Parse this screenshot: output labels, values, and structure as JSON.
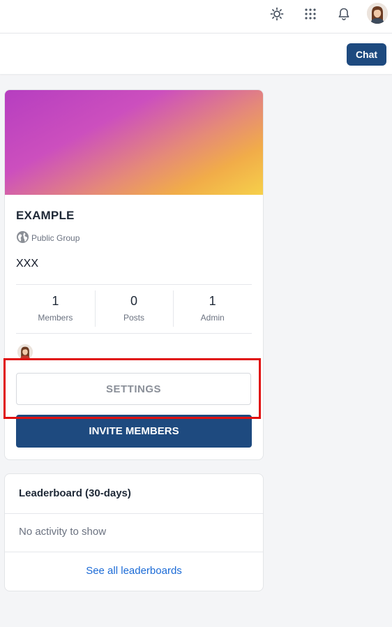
{
  "topbar": {
    "icons": [
      "sun-icon",
      "apps-grid-icon",
      "bell-icon",
      "user-avatar"
    ]
  },
  "subbar": {
    "chat_label": "Chat"
  },
  "group": {
    "name": "EXAMPLE",
    "privacy": "Public Group",
    "description": "XXX",
    "stats": [
      {
        "value": "1",
        "label": "Members"
      },
      {
        "value": "0",
        "label": "Posts"
      },
      {
        "value": "1",
        "label": "Admin"
      }
    ],
    "settings_label": "SETTINGS",
    "invite_label": "INVITE MEMBERS"
  },
  "leaderboard": {
    "title": "Leaderboard (30-days)",
    "empty_text": "No activity to show",
    "link_text": "See all leaderboards"
  },
  "colors": {
    "primary": "#1e4a7f",
    "link": "#1a6ad6",
    "highlight": "#e01010"
  }
}
